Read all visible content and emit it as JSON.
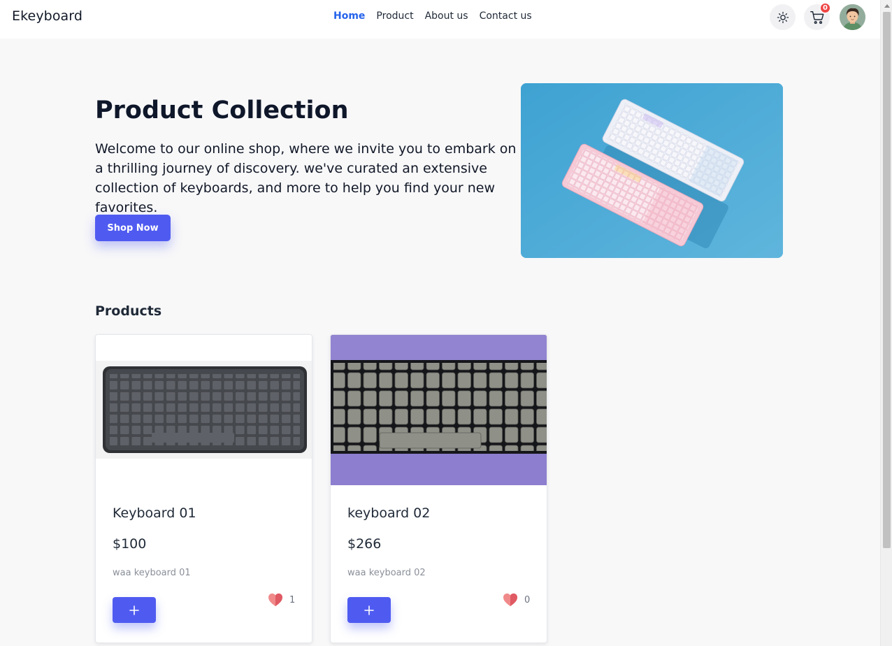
{
  "header": {
    "brand": "Ekeyboard",
    "nav": [
      "Home",
      "Product",
      "About us",
      "Contact us"
    ],
    "active_nav": "Home",
    "cart_count": "0",
    "theme_icon": "sun-icon",
    "cart_icon": "cart-icon"
  },
  "hero": {
    "title": "Product Collection",
    "text": "Welcome to our online shop, where we invite you to embark on a thrilling journey of discovery. we've curated an extensive collection of keyboards, and more to help you find your new favorites.",
    "button": "Shop Now"
  },
  "products": {
    "title": "Products",
    "items": [
      {
        "name": "Keyboard 01",
        "price": "$100",
        "description": "waa keyboard 01",
        "likes": "1",
        "add_label": "+"
      },
      {
        "name": "keyboard 02",
        "price": "$266",
        "description": "waa keyboard 02",
        "likes": "0",
        "add_label": "+"
      }
    ]
  },
  "colors": {
    "accent": "#4f5bf0",
    "active_nav": "#2563eb",
    "badge": "#ef4444",
    "hero_image_bg": "#47a8d6",
    "card2_image_bg": "#8b7dcb"
  }
}
